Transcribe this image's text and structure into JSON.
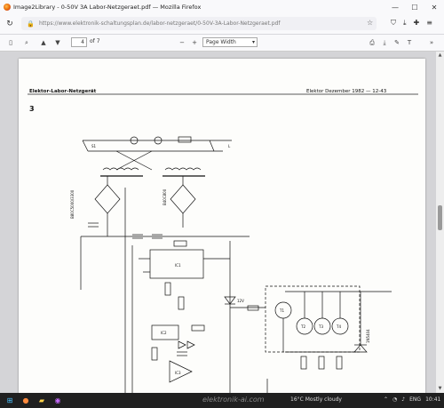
{
  "window": {
    "title": "Image2Library - 0-50V 3A Labor-Netzgeraet.pdf — Mozilla Firefox",
    "controls": {
      "minimize": "—",
      "maximize": "☐",
      "close": "✕"
    }
  },
  "urlbar": {
    "url": "https://www.elektronik-schaltungsplan.de/labor-netzgeraet/0-50V-3A-Labor-Netzgeraet.pdf",
    "star": "☆"
  },
  "pdf_toolbar": {
    "page_current": "4",
    "page_count": "of 7",
    "zoom": "Page Width",
    "zoom_out": "−",
    "zoom_in": "+"
  },
  "document": {
    "header_left": "Elektor-Labor-Netzgerät",
    "header_right": "Elektor Dezember 1982 — 12-43",
    "figure_number": "3",
    "component_labels": {
      "bridge_1": "B80C5000/3300",
      "bridge_2": "B40C800",
      "ic_main": "IC1",
      "ic_regulator": "IC2",
      "ic_opamp": "IC3",
      "transistor_1": "T1",
      "transistor_2": "T2",
      "transistor_3": "T3",
      "transistor_4": "T4",
      "diode_zener": "12V",
      "diode_out": "1N5404",
      "switch_label": "S1",
      "source_label": "L"
    }
  },
  "taskbar": {
    "weather": "16°C  Mostly cloudy",
    "watermark": "elektronik-ai.com",
    "tray_lang": "ENG",
    "tray_time": "10:41"
  },
  "colors": {
    "chrome": "#f9f9fb",
    "viewer_bg": "#d4d4d7",
    "taskbar": "#202020",
    "ink": "#111111"
  }
}
